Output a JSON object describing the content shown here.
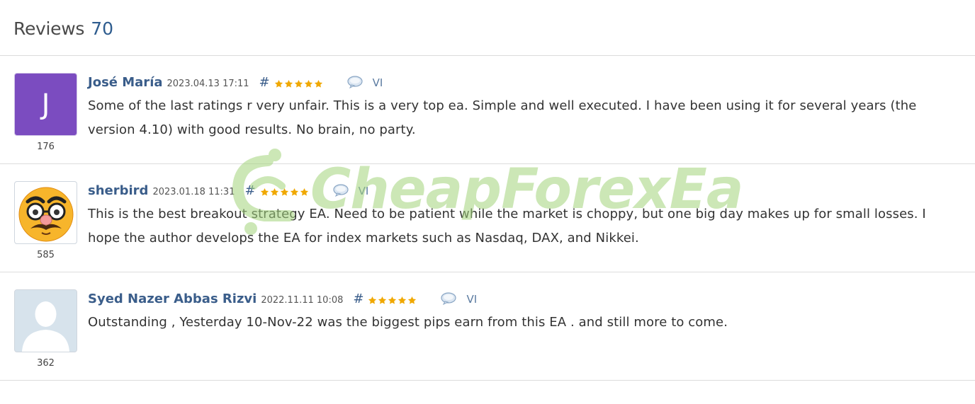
{
  "header": {
    "title": "Reviews",
    "count": "70"
  },
  "reviews": [
    {
      "avatar_type": "letter",
      "avatar_letter": "J",
      "rating_count": "176",
      "author": "José María",
      "date": "2023.04.13 17:11",
      "hash": "#",
      "stars": 5,
      "lang": "VI",
      "text": "Some of the last ratings r very unfair. This is a very top ea. Simple and well executed. I have been using it for several years (the version 4.10) with good results. No brain, no party."
    },
    {
      "avatar_type": "emoji",
      "avatar_icon": "disguised-face-icon",
      "rating_count": "585",
      "author": "sherbird",
      "date": "2023.01.18 11:31",
      "hash": "#",
      "stars": 5,
      "lang": "VI",
      "text": "This is the best breakout strategy EA. Need to be patient while the market is choppy, but one big day makes up for small losses. I hope the author develops the EA for index markets such as Nasdaq, DAX, and Nikkei."
    },
    {
      "avatar_type": "silhouette",
      "avatar_icon": "default-user-icon",
      "rating_count": "362",
      "author": "Syed Nazer Abbas Rizvi",
      "date": "2022.11.11 10:08",
      "hash": "#",
      "stars": 5,
      "lang": "VI",
      "text": "Outstanding , Yesterday 10-Nov-22 was the biggest pips earn from this EA . and still more to come."
    }
  ],
  "watermark": {
    "text": "CheapForexEa"
  },
  "colors": {
    "link": "#3a5d8a",
    "star": "#f0a800",
    "letter_avatar": "#7b4cc0",
    "watermark": "#a3d47c"
  },
  "icons": {
    "star": "star-icon",
    "reply": "speech-bubble-icon"
  }
}
